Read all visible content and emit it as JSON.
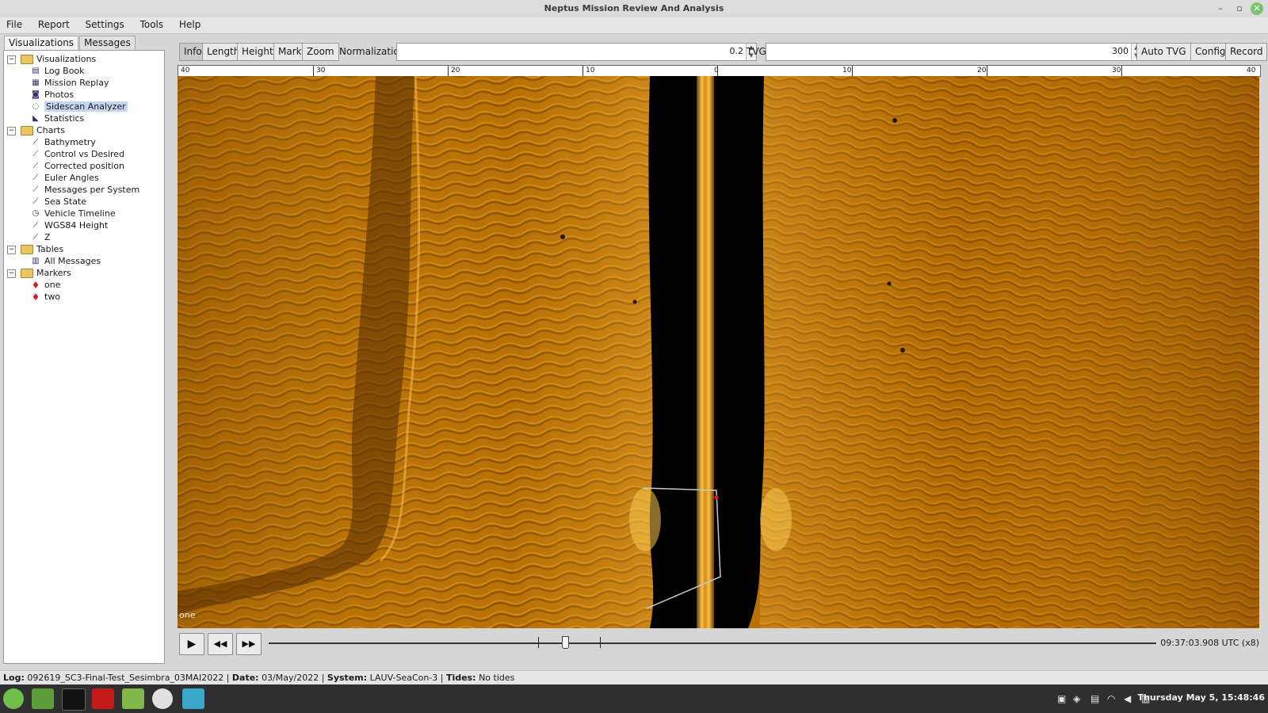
{
  "window": {
    "title": "Neptus Mission Review And Analysis",
    "min_glyph": "–",
    "max_glyph": "▫",
    "close_glyph": "✕"
  },
  "menu": [
    "File",
    "Report",
    "Settings",
    "Tools",
    "Help"
  ],
  "left_tabs": [
    "Visualizations",
    "Messages"
  ],
  "tree": {
    "visualizations": {
      "label": "Visualizations",
      "items": [
        "Log Book",
        "Mission Replay",
        "Photos",
        "Sidescan Analyzer",
        "Statistics"
      ]
    },
    "charts": {
      "label": "Charts",
      "items": [
        "Bathymetry",
        "Control vs Desired",
        "Corrected position",
        "Euler Angles",
        "Messages per System",
        "Sea State",
        "Vehicle Timeline",
        "WGS84 Height",
        "Z"
      ]
    },
    "tables": {
      "label": "Tables",
      "items": [
        "All Messages"
      ]
    },
    "markers": {
      "label": "Markers",
      "items": [
        "one",
        "two"
      ]
    },
    "selected": "Sidescan Analyzer"
  },
  "toolbar": {
    "info": "Info",
    "length": "Length",
    "height": "Height",
    "mark": "Mark",
    "zoom": "Zoom",
    "normalization_label": "Normalization",
    "normalization_value": "0.2",
    "tvg_label": "TVG",
    "tvg_value": "300",
    "auto_tvg": "Auto TVG",
    "config": "Config",
    "record": "Record",
    "active": "Info"
  },
  "ruler_labels": [
    "40",
    "30",
    "20",
    "10",
    "0",
    "10",
    "20",
    "30",
    "40"
  ],
  "sonar": {
    "marker_label": "one"
  },
  "playback": {
    "play_glyph": "▶",
    "rewind_glyph": "◀◀",
    "forward_glyph": "▶▶",
    "time": "09:37:03.908 UTC (x8)"
  },
  "status": {
    "log_label": "Log:",
    "log_value": "092619_SC3-Final-Test_Sesimbra_03MAI2022",
    "date_label": "Date:",
    "date_value": "03/May/2022",
    "system_label": "System:",
    "system_value": "LAUV-SeaCon-3",
    "tides_label": "Tides:",
    "tides_value": "No tides"
  },
  "taskbar": {
    "clock": "Thursday May 5, 15:48:46"
  },
  "colors": {
    "sonar_base": "#b86f06",
    "sonar_light": "#e6a222",
    "sonar_dark": "#6b3a02",
    "nadir": "#000000",
    "accent_selection": "#c5d7ef"
  }
}
